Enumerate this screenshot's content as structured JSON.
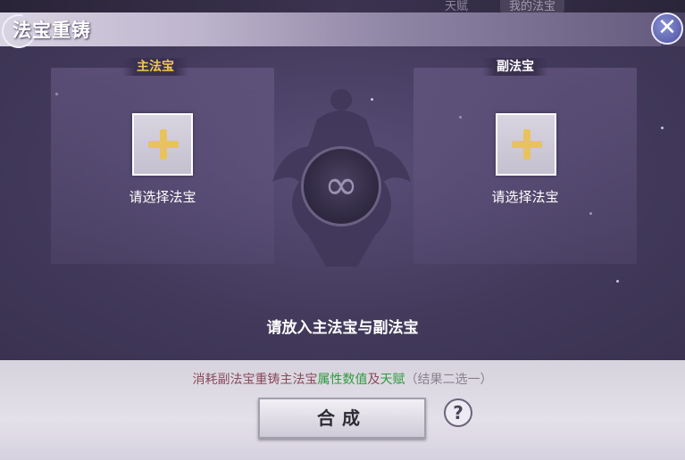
{
  "background": {
    "tab_talent": "天赋",
    "tab_my_treasure": "我的法宝"
  },
  "window": {
    "title": "法宝重铸",
    "close_icon": "close-icon"
  },
  "slots": {
    "main": {
      "label": "主法宝",
      "hint": "请选择法宝"
    },
    "sub": {
      "label": "副法宝",
      "hint": "请选择法宝"
    }
  },
  "center_message": "请放入主法宝与副法宝",
  "cost": {
    "prefix": "消耗副法宝重铸主法宝",
    "attr": "属性数值",
    "and": "及",
    "talent": "天赋",
    "suffix": "（结果二选一）"
  },
  "buttons": {
    "combine": "合成",
    "help": "?"
  },
  "colors": {
    "main_label": "#f2c94c",
    "highlight_green": "#2e9b3e",
    "cost_text": "#8a4b5a"
  }
}
